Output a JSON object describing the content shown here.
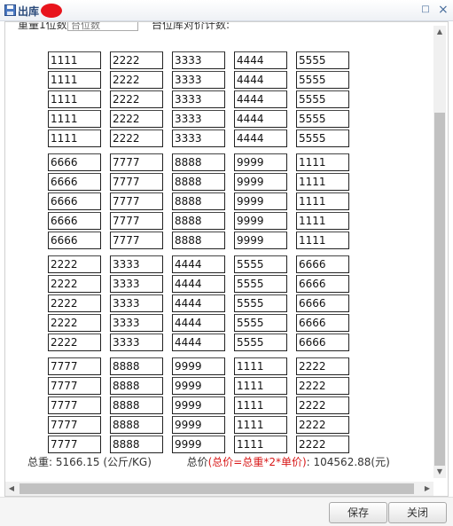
{
  "window": {
    "title": "出库",
    "close_glyph": "×",
    "maximize_glyph": "□"
  },
  "top_partial": {
    "label": "重量1位数:",
    "value": "台位数",
    "right_label": "台位库对价计数:"
  },
  "grid": [
    {
      "values": [
        "1111",
        "2222",
        "3333",
        "4444",
        "5555"
      ]
    },
    {
      "values": [
        "6666",
        "7777",
        "8888",
        "9999",
        "1111"
      ]
    },
    {
      "values": [
        "2222",
        "3333",
        "4444",
        "5555",
        "6666"
      ]
    },
    {
      "values": [
        "7777",
        "8888",
        "9999",
        "1111",
        "2222"
      ]
    }
  ],
  "rows_per_block": 5,
  "totals": {
    "weight_label": "总重:",
    "weight_value": "5166.15",
    "weight_unit": "(公斤/KG)",
    "price_label": "总价",
    "price_formula": "(总价=总重*2*单价)",
    "price_colon": ":",
    "price_value": "104562.88",
    "price_unit": "(元)"
  },
  "buttons": {
    "save": "保存",
    "close": "关闭"
  },
  "colors": {
    "title": "#2a4a7a",
    "formula_red": "#d81818"
  }
}
